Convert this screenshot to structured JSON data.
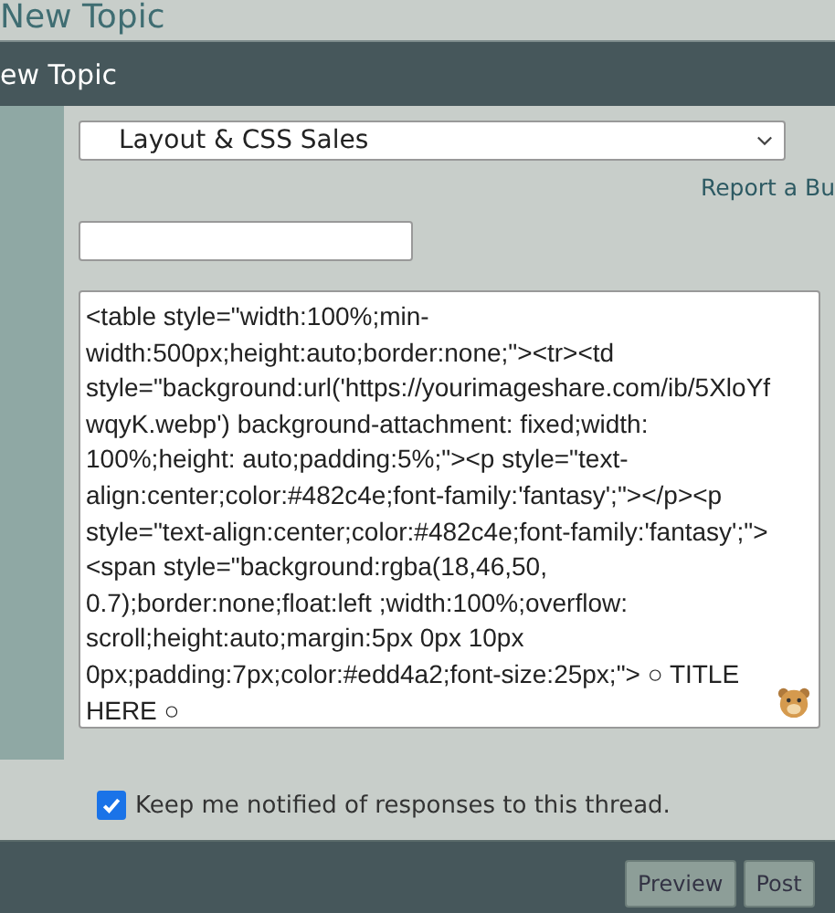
{
  "page_title": "New Topic",
  "panel": {
    "title": "ew Topic"
  },
  "forum_select": {
    "value": "Layout & CSS Sales"
  },
  "report_link": "Report a Bu",
  "message": {
    "value": "<table style=\"width:100%;min-width:500px;height:auto;border:none;\"><tr><td style=\"background:url('https://yourimageshare.com/ib/5XloYfwqyK.webp') background-attachment: fixed;width: 100%;height: auto;padding:5%;\"><p style=\"text-align:center;color:#482c4e;font-family:'fantasy';\"></p><p style=\"text-align:center;color:#482c4e;font-family:'fantasy';\"><span style=\"background:rgba(18,46,50, 0.7);border:none;float:left ;width:100%;overflow: scroll;height:auto;margin:5px 0px 10px 0px;padding:7px;color:#edd4a2;font-size:25px;\"> ○ TITLE HERE ○"
  },
  "notify": {
    "label": "Keep me notified of responses to this thread.",
    "checked": true
  },
  "buttons": [
    "Preview",
    "Post"
  ]
}
